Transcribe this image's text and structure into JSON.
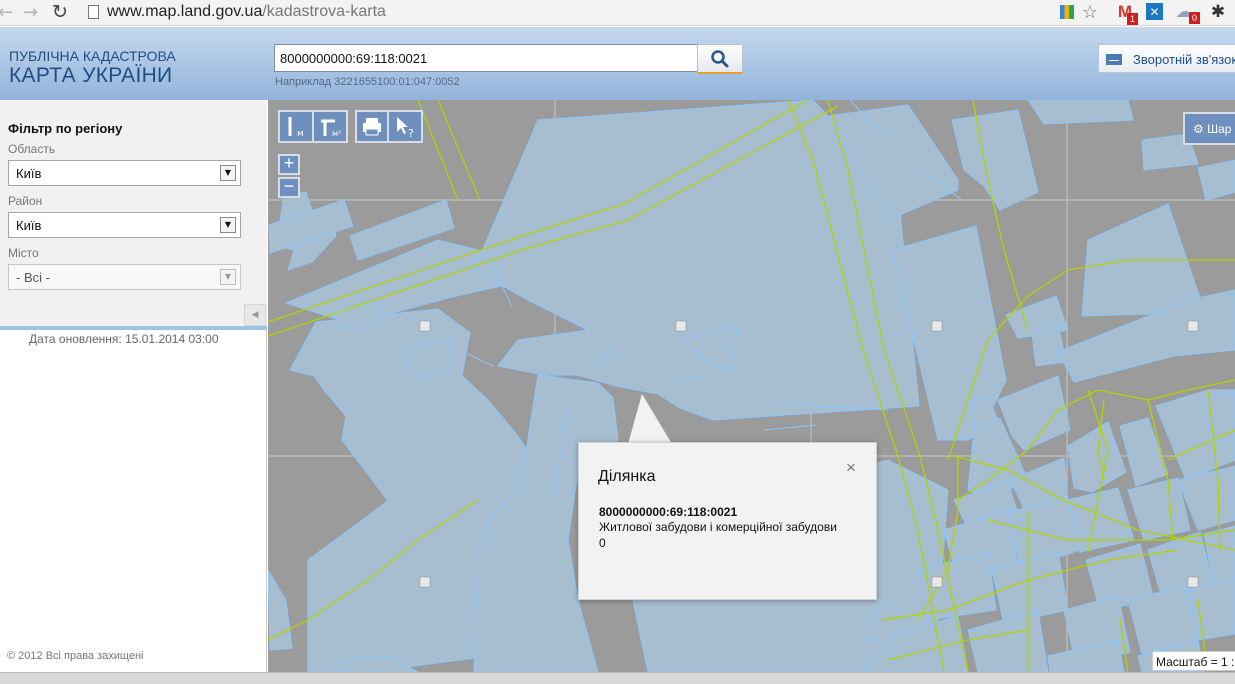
{
  "browser": {
    "back_label": "←",
    "forward_label": "→",
    "reload_label": "↻",
    "url_host": "www.map.land.gov.ua",
    "url_path": "/kadastrova-karta",
    "star_label": "☆",
    "gmail_label": "M",
    "gmail_badge": "1",
    "weather_badge": "0"
  },
  "header": {
    "logo_line1": "ПУБЛІЧНА КАДАСТРОВА",
    "logo_line2": "КАРТА УКРАЇНИ",
    "search_value": "8000000000:69:118:0021",
    "search_icon": "search-icon",
    "example_text": "Наприклад 3221655100:01:047:0052",
    "feedback_label": "Зворотній зв'язок"
  },
  "sidebar": {
    "filter_title": "Фільтр по регіону",
    "region_label": "Область",
    "region_value": "Київ",
    "district_label": "Район",
    "district_value": "Київ",
    "city_label": "Місто",
    "city_value": "- Всі -",
    "collapse_label": "◀",
    "update_date": "Дата оновлення: 15.01.2014 03:00",
    "copyright": "© 2012 Всі права захищені"
  },
  "map": {
    "tools": [
      "ruler-icon",
      "area-icon",
      "print-icon",
      "info-cursor-icon"
    ],
    "zoom_in": "+",
    "zoom_out": "−",
    "settings_label": "Шар",
    "scale_label": "Масштаб = 1 :",
    "popup": {
      "title": "Ділянка",
      "close": "×",
      "cadastral_number": "8000000000:69:118:0021",
      "purpose": "Житлової забудови і комерційної забудови",
      "area": "0"
    }
  },
  "colors": {
    "header_blue": "#92b4da",
    "parcel_fill": "#a7bdd0",
    "parcel_line": "#8ac8ff",
    "boundary_line": "#b2d400"
  }
}
